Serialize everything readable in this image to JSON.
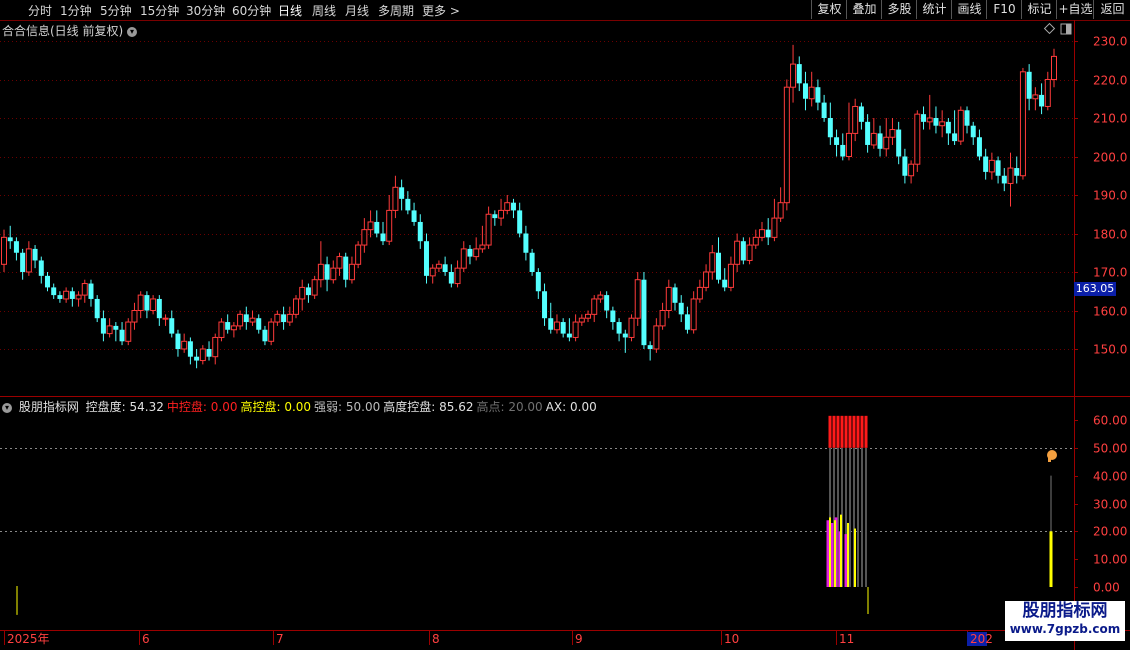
{
  "toolbar": {
    "periods": [
      "分时",
      "1分钟",
      "5分钟",
      "15分钟",
      "30分钟",
      "60分钟",
      "日线",
      "周线",
      "月线",
      "多周期",
      "更多 >"
    ],
    "active_period": "日线",
    "buttons": [
      "复权",
      "叠加",
      "多股",
      "统计",
      "画线",
      "F10",
      "标记",
      "+自选",
      "返回"
    ]
  },
  "main_chart": {
    "title": "合合信息(日线 前复权)",
    "current_price": "163.05",
    "y_ticks": [
      "230.0",
      "220.0",
      "210.0",
      "200.0",
      "190.0",
      "180.0",
      "170.0",
      "160.0",
      "150.0"
    ],
    "up_color": "#ff3b3b",
    "down_color": "#54ffff"
  },
  "indicator": {
    "name": "股朋指标网",
    "items": [
      {
        "label": "控盘度: 54.32",
        "color": "#e0e0e0"
      },
      {
        "label": "中控盘: 0.00",
        "color": "#ff2020"
      },
      {
        "label": "高控盘: 0.00",
        "color": "#ffff00"
      },
      {
        "label": "强弱: 50.00",
        "color": "#bbbbbb"
      },
      {
        "label": "高度控盘: 85.62",
        "color": "#e0e0e0"
      },
      {
        "label": "高点: 20.00",
        "color": "#707070"
      },
      {
        "label": "AX: 0.00",
        "color": "#e0e0e0"
      }
    ],
    "y_ticks": [
      "60.00",
      "50.00",
      "40.00",
      "30.00",
      "20.00",
      "10.00",
      "0.00"
    ]
  },
  "x_axis": {
    "labels": [
      "2025年",
      "6",
      "7",
      "8",
      "9",
      "10",
      "11",
      "202"
    ]
  },
  "watermark": {
    "line1": "股朋指标网",
    "line2": "www.7gpzb.com"
  },
  "chart_data": {
    "type": "candlestick",
    "title": "合合信息(日线 前复权)",
    "ylim": [
      142,
      233
    ],
    "up_color": "#ff3b3b",
    "down_color": "#54ffff",
    "candles": [
      [
        172,
        179,
        170,
        181
      ],
      [
        179,
        178,
        176,
        182
      ],
      [
        178,
        175,
        173,
        179
      ],
      [
        175,
        170,
        168,
        176
      ],
      [
        170,
        176,
        169,
        178
      ],
      [
        176,
        173,
        171,
        177
      ],
      [
        173,
        169,
        167,
        174
      ],
      [
        169,
        166,
        165,
        170
      ],
      [
        166,
        164,
        163,
        167
      ],
      [
        164,
        163,
        162,
        165
      ],
      [
        163,
        165,
        162,
        166
      ],
      [
        165,
        163,
        161,
        166
      ],
      [
        163,
        164,
        161,
        165
      ],
      [
        164,
        167,
        162,
        168
      ],
      [
        167,
        163,
        161,
        168
      ],
      [
        163,
        158,
        157,
        164
      ],
      [
        158,
        154,
        152,
        160
      ],
      [
        154,
        156,
        153,
        158
      ],
      [
        156,
        155,
        152,
        157
      ],
      [
        155,
        152,
        151,
        157
      ],
      [
        152,
        157,
        151,
        158
      ],
      [
        157,
        160,
        155,
        162
      ],
      [
        160,
        164,
        158,
        165
      ],
      [
        164,
        160,
        158,
        165
      ],
      [
        160,
        163,
        159,
        164
      ],
      [
        163,
        158,
        156,
        164
      ],
      [
        158,
        158,
        156,
        159
      ],
      [
        158,
        154,
        153,
        160
      ],
      [
        154,
        150,
        148,
        155
      ],
      [
        150,
        152,
        149,
        154
      ],
      [
        152,
        148,
        146,
        153
      ],
      [
        148,
        147,
        145,
        150
      ],
      [
        147,
        150,
        146,
        151
      ],
      [
        150,
        148,
        147,
        152
      ],
      [
        148,
        153,
        146,
        154
      ],
      [
        153,
        157,
        152,
        158
      ],
      [
        157,
        155,
        154,
        159
      ],
      [
        155,
        156,
        153,
        157
      ],
      [
        156,
        159,
        155,
        160
      ],
      [
        159,
        157,
        155,
        161
      ],
      [
        157,
        158,
        156,
        160
      ],
      [
        158,
        155,
        154,
        159
      ],
      [
        155,
        152,
        151,
        156
      ],
      [
        152,
        157,
        151,
        158
      ],
      [
        157,
        159,
        156,
        160
      ],
      [
        159,
        157,
        155,
        161
      ],
      [
        157,
        159,
        156,
        161
      ],
      [
        159,
        163,
        158,
        164
      ],
      [
        163,
        166,
        160,
        168
      ],
      [
        166,
        164,
        162,
        167
      ],
      [
        164,
        168,
        163,
        169
      ],
      [
        168,
        172,
        166,
        178
      ],
      [
        172,
        168,
        165,
        174
      ],
      [
        168,
        171,
        167,
        173
      ],
      [
        171,
        174,
        169,
        175
      ],
      [
        174,
        168,
        166,
        175
      ],
      [
        168,
        172,
        167,
        174
      ],
      [
        172,
        177,
        171,
        178
      ],
      [
        177,
        181,
        175,
        184
      ],
      [
        181,
        183,
        179,
        186
      ],
      [
        183,
        180,
        179,
        186
      ],
      [
        180,
        178,
        177,
        183
      ],
      [
        178,
        186,
        177,
        190
      ],
      [
        186,
        192,
        184,
        195
      ],
      [
        192,
        189,
        186,
        194
      ],
      [
        189,
        186,
        185,
        191
      ],
      [
        186,
        183,
        182,
        188
      ],
      [
        183,
        178,
        176,
        185
      ],
      [
        178,
        169,
        167,
        180
      ],
      [
        169,
        171,
        167,
        172
      ],
      [
        171,
        172,
        170,
        173
      ],
      [
        172,
        170,
        169,
        174
      ],
      [
        170,
        167,
        166,
        172
      ],
      [
        167,
        171,
        166,
        173
      ],
      [
        171,
        176,
        170,
        178
      ],
      [
        176,
        174,
        172,
        177
      ],
      [
        174,
        176,
        173,
        179
      ],
      [
        176,
        177,
        175,
        182
      ],
      [
        177,
        185,
        176,
        187
      ],
      [
        185,
        184,
        182,
        186
      ],
      [
        184,
        186,
        182,
        189
      ],
      [
        186,
        188,
        185,
        190
      ],
      [
        188,
        186,
        184,
        189
      ],
      [
        186,
        180,
        179,
        188
      ],
      [
        180,
        175,
        173,
        182
      ],
      [
        175,
        170,
        169,
        176
      ],
      [
        170,
        165,
        163,
        171
      ],
      [
        165,
        158,
        156,
        167
      ],
      [
        158,
        155,
        154,
        162
      ],
      [
        155,
        157,
        154,
        159
      ],
      [
        157,
        154,
        153,
        158
      ],
      [
        154,
        153,
        152,
        158
      ],
      [
        153,
        157,
        152,
        159
      ],
      [
        157,
        158,
        156,
        159
      ],
      [
        158,
        159,
        157,
        160
      ],
      [
        159,
        163,
        157,
        164
      ],
      [
        163,
        164,
        162,
        165
      ],
      [
        164,
        160,
        158,
        165
      ],
      [
        160,
        157,
        155,
        161
      ],
      [
        157,
        154,
        152,
        158
      ],
      [
        154,
        153,
        149,
        155
      ],
      [
        153,
        158,
        152,
        159
      ],
      [
        158,
        168,
        156,
        170
      ],
      [
        168,
        151,
        150,
        170
      ],
      [
        151,
        150,
        147,
        152
      ],
      [
        150,
        156,
        149,
        158
      ],
      [
        156,
        160,
        155,
        162
      ],
      [
        160,
        166,
        158,
        168
      ],
      [
        166,
        162,
        160,
        167
      ],
      [
        162,
        159,
        157,
        164
      ],
      [
        159,
        155,
        154,
        161
      ],
      [
        155,
        163,
        154,
        165
      ],
      [
        163,
        166,
        162,
        168
      ],
      [
        166,
        170,
        165,
        172
      ],
      [
        170,
        175,
        168,
        177
      ],
      [
        175,
        168,
        167,
        179
      ],
      [
        168,
        166,
        165,
        171
      ],
      [
        166,
        172,
        165,
        174
      ],
      [
        172,
        178,
        170,
        180
      ],
      [
        178,
        173,
        172,
        179
      ],
      [
        173,
        177,
        172,
        179
      ],
      [
        177,
        179,
        176,
        181
      ],
      [
        179,
        181,
        178,
        183
      ],
      [
        181,
        179,
        177,
        184
      ],
      [
        179,
        184,
        178,
        189
      ],
      [
        184,
        188,
        183,
        192
      ],
      [
        188,
        218,
        186,
        220
      ],
      [
        218,
        224,
        214,
        229
      ],
      [
        224,
        219,
        217,
        226
      ],
      [
        219,
        215,
        212,
        222
      ],
      [
        215,
        218,
        213,
        222
      ],
      [
        218,
        214,
        212,
        220
      ],
      [
        214,
        210,
        209,
        216
      ],
      [
        210,
        205,
        203,
        214
      ],
      [
        205,
        203,
        200,
        207
      ],
      [
        203,
        200,
        199,
        206
      ],
      [
        200,
        206,
        199,
        214
      ],
      [
        206,
        213,
        204,
        215
      ],
      [
        213,
        209,
        207,
        214
      ],
      [
        209,
        203,
        201,
        211
      ],
      [
        203,
        206,
        202,
        210
      ],
      [
        206,
        202,
        200,
        208
      ],
      [
        202,
        205,
        200,
        210
      ],
      [
        205,
        207,
        203,
        210
      ],
      [
        207,
        200,
        198,
        209
      ],
      [
        200,
        195,
        193,
        202
      ],
      [
        195,
        198,
        193,
        199
      ],
      [
        198,
        211,
        196,
        212
      ],
      [
        211,
        209,
        207,
        213
      ],
      [
        209,
        210,
        207,
        216
      ],
      [
        210,
        208,
        206,
        213
      ],
      [
        208,
        209,
        205,
        212
      ],
      [
        209,
        206,
        203,
        210
      ],
      [
        206,
        204,
        203,
        212
      ],
      [
        204,
        212,
        203,
        213
      ],
      [
        212,
        208,
        206,
        213
      ],
      [
        208,
        205,
        203,
        209
      ],
      [
        205,
        200,
        199,
        207
      ],
      [
        200,
        196,
        194,
        202
      ],
      [
        196,
        199,
        194,
        201
      ],
      [
        199,
        195,
        193,
        200
      ],
      [
        195,
        193,
        191,
        197
      ],
      [
        193,
        197,
        187,
        201
      ],
      [
        197,
        195,
        193,
        200
      ],
      [
        195,
        222,
        194,
        223
      ],
      [
        222,
        215,
        212,
        224
      ],
      [
        215,
        216,
        212,
        218
      ],
      [
        216,
        213,
        211,
        219
      ],
      [
        213,
        220,
        212,
        222
      ],
      [
        220,
        226,
        218,
        228
      ]
    ]
  }
}
